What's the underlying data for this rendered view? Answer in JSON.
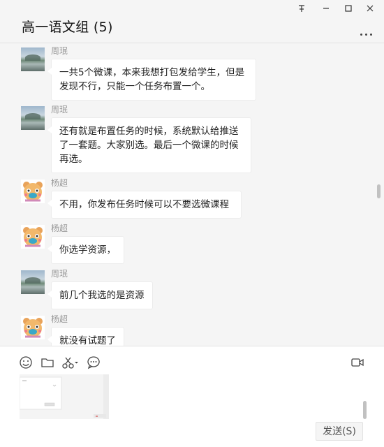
{
  "window": {
    "title": "高一语文组 (5)",
    "pin_glyph": "⽂",
    "minimize_glyph": "—",
    "maximize_glyph": "☐",
    "close_glyph": "✕"
  },
  "messages": [
    {
      "sender": "周珉",
      "text": "一共5个微课，本来我想打包发给学生，但是发现不行，只能一个任务布置一个。"
    },
    {
      "sender": "周珉",
      "text": "还有就是布置任务的时候，系统默认给推送了一套题。大家别选。最后一个微课的时候再选。"
    },
    {
      "sender": "杨超",
      "text": "不用，你发布任务时候可以不要选微课程"
    },
    {
      "sender": "杨超",
      "text": "你选学资源，"
    },
    {
      "sender": "周珉",
      "text": "前几个我选的是资源"
    },
    {
      "sender": "杨超",
      "text": "就没有试题了"
    }
  ],
  "toolbar": {
    "icons": [
      "emoji-icon",
      "folder-icon",
      "scissors-icon",
      "chat-history-icon",
      "video-call-icon"
    ]
  },
  "send_label": "发送(S)"
}
